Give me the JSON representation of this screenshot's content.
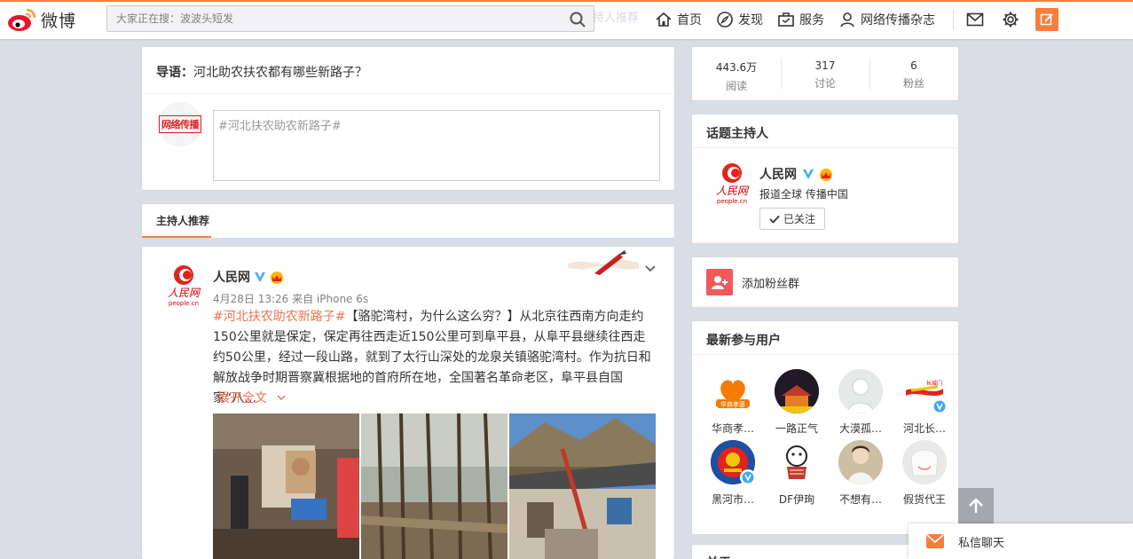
{
  "header": {
    "logo_text": "微博",
    "search_placeholder": "大家正在搜：波波头短发",
    "ghost_text": "持人推荐",
    "nav": [
      {
        "label": "首页",
        "icon": "home-icon"
      },
      {
        "label": "发现",
        "icon": "compass-icon"
      },
      {
        "label": "服务",
        "icon": "briefcase-icon"
      },
      {
        "label": "网络传播杂志",
        "icon": "user-icon"
      }
    ],
    "accent": "#fa7d3c"
  },
  "guide": {
    "prefix": "导语：",
    "text": "河北助农扶农都有哪些新路子？"
  },
  "composer": {
    "avatar_text": "网络传播",
    "placeholder": "#河北扶农助农新路子#"
  },
  "host_recommend": {
    "label": "主持人推荐"
  },
  "post": {
    "author": "人民网",
    "meta": "4月28日 13:26 来自 iPhone 6s",
    "hashtag": "#河北扶农助农新路子#",
    "body": "【骆驼湾村，为什么这么穷？】从北京往西南方向走约150公里就是保定，保定再往西走近150公里可到阜平县，从阜平县继续往西走约50公里，经过一段山路，就到了太行山深处的龙泉关镇骆驼湾村。作为抗日和解放战争时期晋察冀根据地的首府所在地，全国著名革命老区，阜平县自国家“八…",
    "expand_label": "展开全文"
  },
  "stats": [
    {
      "value": "443.6万",
      "label": "阅读"
    },
    {
      "value": "317",
      "label": "讨论"
    },
    {
      "value": "6",
      "label": "粉丝"
    }
  ],
  "host": {
    "title": "话题主持人",
    "name": "人民网",
    "desc": "报道全球 传播中国",
    "follow_label": "已关注"
  },
  "fans_group": {
    "label": "添加粉丝群"
  },
  "latest_users": {
    "title": "最新参与用户",
    "users": [
      {
        "name": "华商孝…",
        "verified": false
      },
      {
        "name": "一路正气",
        "verified": false
      },
      {
        "name": "大漠孤…",
        "verified": false
      },
      {
        "name": "河北长…",
        "verified": true
      },
      {
        "name": "黑河市…",
        "verified": true
      },
      {
        "name": "DF伊珣",
        "verified": false
      },
      {
        "name": "不想有…",
        "verified": false
      },
      {
        "name": "假货代王",
        "verified": false
      }
    ]
  },
  "next_section": {
    "title": "关于"
  },
  "chat": {
    "label": "私信聊天"
  }
}
